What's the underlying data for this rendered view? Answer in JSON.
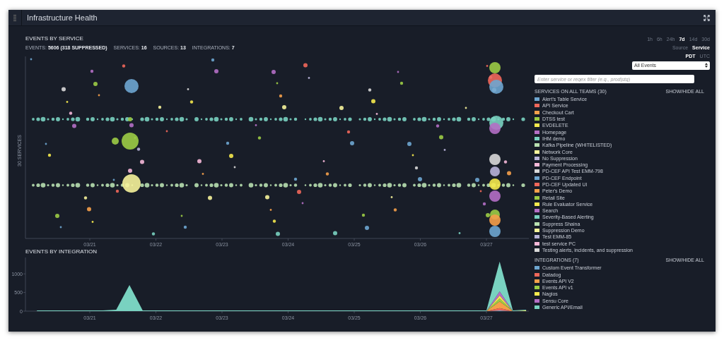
{
  "window": {
    "title": "Infrastructure Health"
  },
  "events_by_service": {
    "title": "EVENTS BY SERVICE",
    "stats": [
      "EVENTS: **5606 (318 SUPPRESSED)**",
      "SERVICES: **16**",
      "SOURCES: **13**",
      "INTEGRATIONS: **7**"
    ],
    "y_label": "30 SERVICES",
    "x_labels": [
      "03/21",
      "03/22",
      "03/23",
      "03/24",
      "03/25",
      "03/26",
      "03/27"
    ]
  },
  "time_ranges": [
    {
      "label": "1h",
      "selected": false
    },
    {
      "label": "6h",
      "selected": false
    },
    {
      "label": "24h",
      "selected": false
    },
    {
      "label": "7d",
      "selected": true
    },
    {
      "label": "14d",
      "selected": false
    },
    {
      "label": "30d",
      "selected": false
    }
  ],
  "group_by": [
    {
      "label": "Source",
      "selected": false
    },
    {
      "label": "Service",
      "selected": true
    }
  ],
  "timezones": [
    {
      "label": "PDT",
      "selected": true
    },
    {
      "label": "UTC",
      "selected": false
    }
  ],
  "event_filter": {
    "value": "All Events"
  },
  "search": {
    "placeholder": "Enter service or regex filter (e.g., prod|stg)"
  },
  "services": {
    "title": "SERVICES ON ALL TEAMS (30)",
    "toggle": "SHOW/HIDE ALL",
    "items": [
      {
        "name": "Alert's Table Service",
        "color": "#6ea6d0"
      },
      {
        "name": "API Service",
        "color": "#f0675a"
      },
      {
        "name": "Checkout Cart",
        "color": "#f5a04a"
      },
      {
        "name": "DTSS test",
        "color": "#9ccc45"
      },
      {
        "name": "EVDELETE",
        "color": "#f5e94d"
      },
      {
        "name": "Homepage",
        "color": "#b46fc5"
      },
      {
        "name": "IHM demo",
        "color": "#79d2c0"
      },
      {
        "name": "Kafka Pipeline (WHITELISTED)",
        "color": "#b8e0b0"
      },
      {
        "name": "Network Core",
        "color": "#f6f39a"
      },
      {
        "name": "No Suppression",
        "color": "#b8b3d8"
      },
      {
        "name": "Payment Processing",
        "color": "#f5b8d8"
      },
      {
        "name": "PD-CEF API Test EMM-798",
        "color": "#d8d8d8"
      },
      {
        "name": "PD-CEF Endpoint",
        "color": "#6ea6d0"
      },
      {
        "name": "PD-CEF Updated UI",
        "color": "#f0675a"
      },
      {
        "name": "Peter's Demo",
        "color": "#f5a04a"
      },
      {
        "name": "Retail Site",
        "color": "#9ccc45"
      },
      {
        "name": "Rule Evaluator Service",
        "color": "#f5e94d"
      },
      {
        "name": "Search",
        "color": "#b46fc5"
      },
      {
        "name": "Severity-Based Alerting",
        "color": "#79d2c0"
      },
      {
        "name": "Suppress Shaina",
        "color": "#b8e0b0"
      },
      {
        "name": "Suppression Demo",
        "color": "#f6f39a"
      },
      {
        "name": "Test EMM-85",
        "color": "#b8b3d8"
      },
      {
        "name": "test service PC",
        "color": "#f5b8d8"
      },
      {
        "name": "Testing alerts, incidents, and suppression",
        "color": "#d8d8d8"
      }
    ]
  },
  "events_by_integration": {
    "title": "EVENTS BY INTEGRATION",
    "legend_title": "INTEGRATIONS (7)",
    "toggle": "SHOW/HIDE ALL",
    "chart_data": {
      "type": "area",
      "stacked": true,
      "categories": [
        null,
        null,
        null,
        null,
        "03/21",
        null,
        null,
        null,
        null,
        "03/22",
        null,
        null,
        null,
        null,
        "03/23",
        null,
        null,
        null,
        null,
        "03/24",
        null,
        null,
        null,
        null,
        "03/25",
        null,
        null,
        null,
        null,
        "03/26",
        null,
        null,
        null,
        null,
        "03/27",
        null,
        null,
        null
      ],
      "ylim": [
        0,
        1400
      ],
      "yticks": [
        0,
        500,
        1000
      ],
      "series": [
        {
          "name": "Custom Event Transformer",
          "color": "#6ea6d0",
          "values": [
            0,
            0,
            0,
            0,
            0,
            0,
            0,
            0,
            0,
            0,
            0,
            0,
            0,
            0,
            0,
            0,
            0,
            0,
            0,
            0,
            0,
            0,
            0,
            0,
            0,
            0,
            0,
            0,
            0,
            0,
            0,
            0,
            0,
            0,
            0,
            20,
            0,
            0
          ]
        },
        {
          "name": "Datadog",
          "color": "#f0675a",
          "values": [
            0,
            0,
            0,
            0,
            0,
            0,
            0,
            0,
            0,
            0,
            0,
            0,
            0,
            0,
            0,
            0,
            0,
            0,
            0,
            0,
            0,
            0,
            0,
            0,
            0,
            0,
            0,
            0,
            0,
            0,
            0,
            0,
            0,
            0,
            0,
            60,
            0,
            0
          ]
        },
        {
          "name": "Events API V2",
          "color": "#f5a04a",
          "values": [
            0,
            0,
            0,
            0,
            0,
            0,
            0,
            0,
            0,
            0,
            0,
            0,
            0,
            0,
            0,
            0,
            0,
            0,
            0,
            0,
            0,
            0,
            0,
            0,
            0,
            0,
            0,
            0,
            0,
            0,
            0,
            0,
            0,
            0,
            0,
            180,
            0,
            0
          ]
        },
        {
          "name": "Events API v1",
          "color": "#9ccc45",
          "values": [
            0,
            0,
            0,
            0,
            0,
            0,
            0,
            0,
            0,
            0,
            0,
            0,
            0,
            0,
            0,
            0,
            0,
            0,
            0,
            0,
            0,
            0,
            0,
            0,
            0,
            0,
            0,
            0,
            0,
            0,
            0,
            0,
            0,
            0,
            0,
            80,
            0,
            0
          ]
        },
        {
          "name": "Nagios",
          "color": "#f5e94d",
          "values": [
            0,
            0,
            0,
            0,
            0,
            0,
            0,
            0,
            0,
            0,
            0,
            0,
            0,
            0,
            0,
            0,
            0,
            0,
            0,
            0,
            0,
            0,
            0,
            0,
            0,
            0,
            0,
            0,
            0,
            0,
            0,
            0,
            0,
            0,
            0,
            80,
            0,
            20
          ]
        },
        {
          "name": "Sensu Core",
          "color": "#b46fc5",
          "values": [
            0,
            0,
            0,
            0,
            0,
            0,
            0,
            0,
            0,
            0,
            0,
            0,
            0,
            0,
            0,
            0,
            0,
            0,
            0,
            0,
            0,
            0,
            0,
            0,
            0,
            0,
            0,
            0,
            0,
            0,
            0,
            0,
            0,
            0,
            0,
            110,
            0,
            0
          ]
        },
        {
          "name": "Generic API/Email",
          "color": "#79d2c0",
          "values": [
            20,
            20,
            20,
            20,
            20,
            20,
            40,
            700,
            20,
            20,
            20,
            20,
            20,
            20,
            20,
            20,
            20,
            20,
            20,
            20,
            20,
            20,
            20,
            20,
            20,
            20,
            20,
            20,
            20,
            20,
            20,
            20,
            20,
            20,
            20,
            800,
            20,
            20
          ]
        }
      ]
    }
  }
}
